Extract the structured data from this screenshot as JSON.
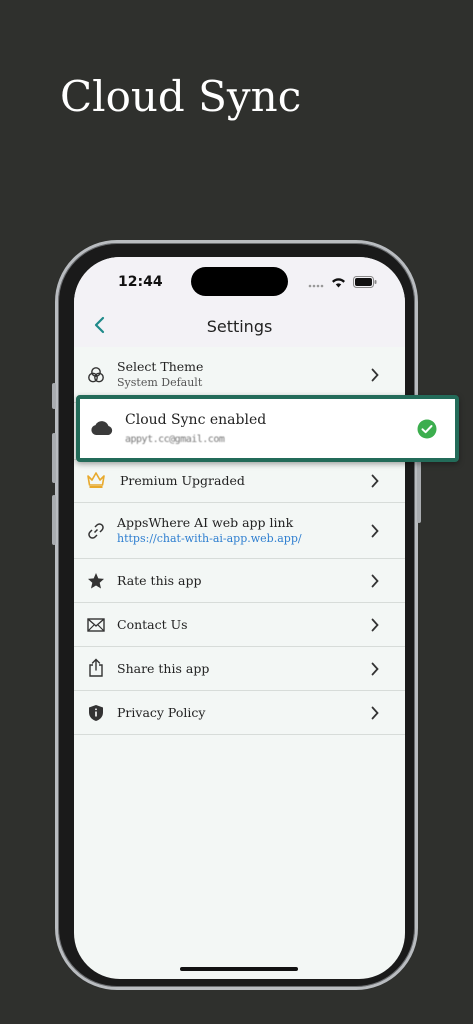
{
  "promo": {
    "title": "Cloud Sync"
  },
  "status_bar": {
    "time": "12:44"
  },
  "nav": {
    "title": "Settings",
    "back_icon": "chevron-left-icon"
  },
  "sync_card": {
    "title": "Cloud Sync enabled",
    "account": "appyt.cc@gmail.com",
    "status_icon": "check-circle-icon",
    "accent_color": "#236b59",
    "check_color": "#3cae4e"
  },
  "settings": [
    {
      "id": "select-theme",
      "icon": "theme-icon",
      "label": "Select Theme",
      "subtitle": "System Default"
    },
    {
      "id": "premium",
      "icon": "crown-icon",
      "label": "Premium Upgraded"
    },
    {
      "id": "web-app-link",
      "icon": "link-icon",
      "label": "AppsWhere AI web app link",
      "subtitle": "https://chat-with-ai-app.web.app/"
    },
    {
      "id": "rate-app",
      "icon": "star-icon",
      "label": "Rate this app"
    },
    {
      "id": "contact-us",
      "icon": "mail-icon",
      "label": "Contact Us"
    },
    {
      "id": "share-app",
      "icon": "share-icon",
      "label": "Share this app"
    },
    {
      "id": "privacy-policy",
      "icon": "shield-icon",
      "label": "Privacy Policy"
    }
  ],
  "colors": {
    "background": "#2f302d",
    "screen_bg": "#f3f7f5",
    "accent": "#1f8a8a",
    "link": "#2f7fd0",
    "crown": "#e8a92c"
  }
}
